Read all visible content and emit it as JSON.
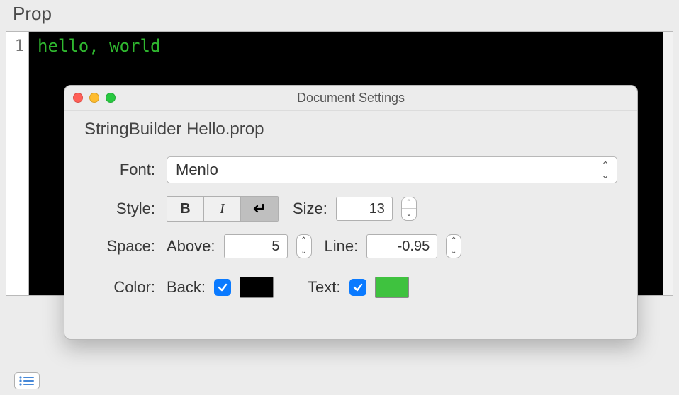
{
  "tab": {
    "label": "Prop"
  },
  "editor": {
    "line_number": "1",
    "content": "hello, world"
  },
  "dialog": {
    "title": "Document Settings",
    "subtitle": "StringBuilder Hello.prop",
    "font_label": "Font:",
    "font_value": "Menlo",
    "style_label": "Style:",
    "size_label": "Size:",
    "size_value": "13",
    "space_label": "Space:",
    "above_label": "Above:",
    "above_value": "5",
    "line_label": "Line:",
    "line_value": "-0.95",
    "color_label": "Color:",
    "back_label": "Back:",
    "text_label": "Text:",
    "back_checked": true,
    "text_checked": true,
    "back_swatch": "#000000",
    "text_swatch": "#3fc23f"
  }
}
